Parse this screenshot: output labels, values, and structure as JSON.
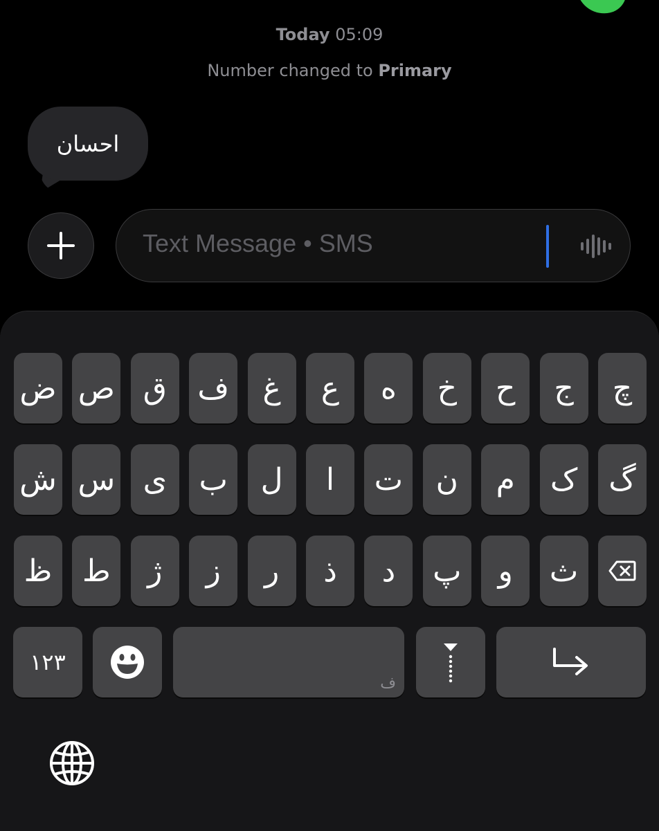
{
  "conversation": {
    "timestamp_day": "Today",
    "timestamp_time": "05:09",
    "note_prefix": "Number changed to",
    "note_value": "Primary",
    "messages": [
      {
        "text": "احسان",
        "direction": "incoming"
      }
    ]
  },
  "composer": {
    "plus_icon": "plus-icon",
    "placeholder": "Text Message • SMS",
    "audio_icon": "waveform-icon"
  },
  "keyboard": {
    "rows": [
      [
        "ض",
        "ص",
        "ق",
        "ف",
        "غ",
        "ع",
        "ه",
        "خ",
        "ح",
        "ج",
        "چ"
      ],
      [
        "ش",
        "س",
        "ی",
        "ب",
        "ل",
        "ا",
        "ت",
        "ن",
        "م",
        "ک",
        "گ"
      ],
      [
        "ظ",
        "ط",
        "ژ",
        "ز",
        "ر",
        "ذ",
        "د",
        "پ",
        "و",
        "ث"
      ]
    ],
    "numbers_key": "۱۲۳",
    "emoji_icon": "emoji-icon",
    "space_hint": "ف",
    "cursor_key_icon": "cursor-insert-icon",
    "return_icon": "return-arrow-icon",
    "delete_icon": "delete-backward-icon",
    "globe_icon": "globe-icon"
  },
  "colors": {
    "background": "#000000",
    "keyboard_bg": "#161618",
    "key_bg": "#444446",
    "bubble_bg": "#262629",
    "caret": "#2f6fe4",
    "accent_green": "#3bc852"
  }
}
